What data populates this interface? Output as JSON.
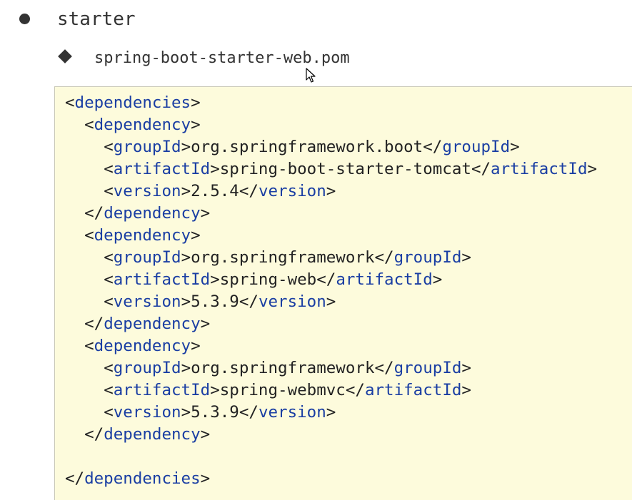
{
  "list": {
    "level1": {
      "label": "starter"
    },
    "level2": {
      "label": "spring-boot-starter-web.pom"
    }
  },
  "code": {
    "lines": [
      {
        "indent": "",
        "open": "dependencies",
        "text": "",
        "close": ""
      },
      {
        "indent": "  ",
        "open": "dependency",
        "text": "",
        "close": ""
      },
      {
        "indent": "    ",
        "open": "groupId",
        "text": "org.springframework.boot",
        "close": "groupId"
      },
      {
        "indent": "    ",
        "open": "artifactId",
        "text": "spring-boot-starter-tomcat",
        "close": "artifactId"
      },
      {
        "indent": "    ",
        "open": "version",
        "text": "2.5.4",
        "close": "version"
      },
      {
        "indent": "  ",
        "open": "",
        "text": "",
        "close": "dependency"
      },
      {
        "indent": "  ",
        "open": "dependency",
        "text": "",
        "close": ""
      },
      {
        "indent": "    ",
        "open": "groupId",
        "text": "org.springframework",
        "close": "groupId"
      },
      {
        "indent": "    ",
        "open": "artifactId",
        "text": "spring-web",
        "close": "artifactId"
      },
      {
        "indent": "    ",
        "open": "version",
        "text": "5.3.9",
        "close": "version"
      },
      {
        "indent": "  ",
        "open": "",
        "text": "",
        "close": "dependency"
      },
      {
        "indent": "  ",
        "open": "dependency",
        "text": "",
        "close": ""
      },
      {
        "indent": "    ",
        "open": "groupId",
        "text": "org.springframework",
        "close": "groupId"
      },
      {
        "indent": "    ",
        "open": "artifactId",
        "text": "spring-webmvc",
        "close": "artifactId"
      },
      {
        "indent": "    ",
        "open": "version",
        "text": "5.3.9",
        "close": "version"
      },
      {
        "indent": "  ",
        "open": "",
        "text": "",
        "close": "dependency"
      },
      {
        "indent": "",
        "open": "",
        "text": "",
        "close": ""
      },
      {
        "indent": "",
        "open": "",
        "text": "",
        "close": "dependencies"
      }
    ]
  },
  "colors": {
    "tag": "#1a3ea3",
    "text": "#222222",
    "code_background": "#fdfbdc",
    "bullet": "#333333"
  },
  "icons": {
    "bullet_level1": "filled-circle-icon",
    "bullet_level2": "filled-diamond-icon",
    "cursor": "mouse-pointer-icon"
  }
}
